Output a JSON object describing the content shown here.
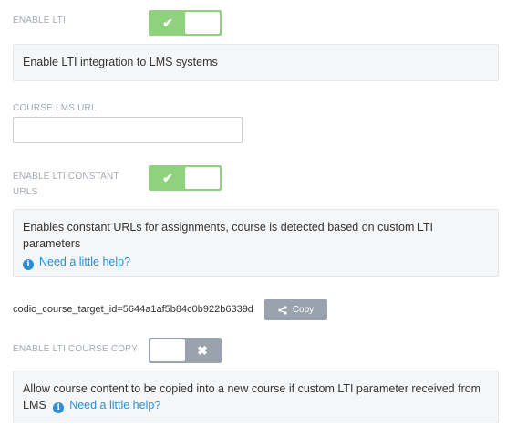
{
  "settings": {
    "lti": {
      "label": "ENABLE LTI",
      "state": "on",
      "description": "Enable LTI integration to LMS systems"
    },
    "lms_url": {
      "label": "COURSE LMS URL",
      "value": ""
    },
    "constant_urls": {
      "label_line1": "ENABLE LTI CONSTANT",
      "label_line2": "URLS",
      "state": "on",
      "description": "Enables constant URLs for assignments, course is detected based on custom LTI parameters",
      "help_link": "Need a little help?"
    },
    "target": {
      "text": "codio_course_target_id=5644a1af5b84c0b922b6339d",
      "copy_label": "Copy"
    },
    "course_copy": {
      "label": "ENABLE LTI COURSE COPY",
      "state": "off",
      "description": "Allow course content to be copied into a new course if custom LTI parameter received from LMS",
      "help_link": "Need a little help?"
    }
  },
  "icons": {
    "check": "✔",
    "cross": "✖",
    "info": "i",
    "share": "share-icon"
  },
  "colors": {
    "toggle_on": "#8fd17c",
    "toggle_off": "#9aa3ad",
    "link": "#2a8fd4",
    "label": "#a3aab3"
  }
}
